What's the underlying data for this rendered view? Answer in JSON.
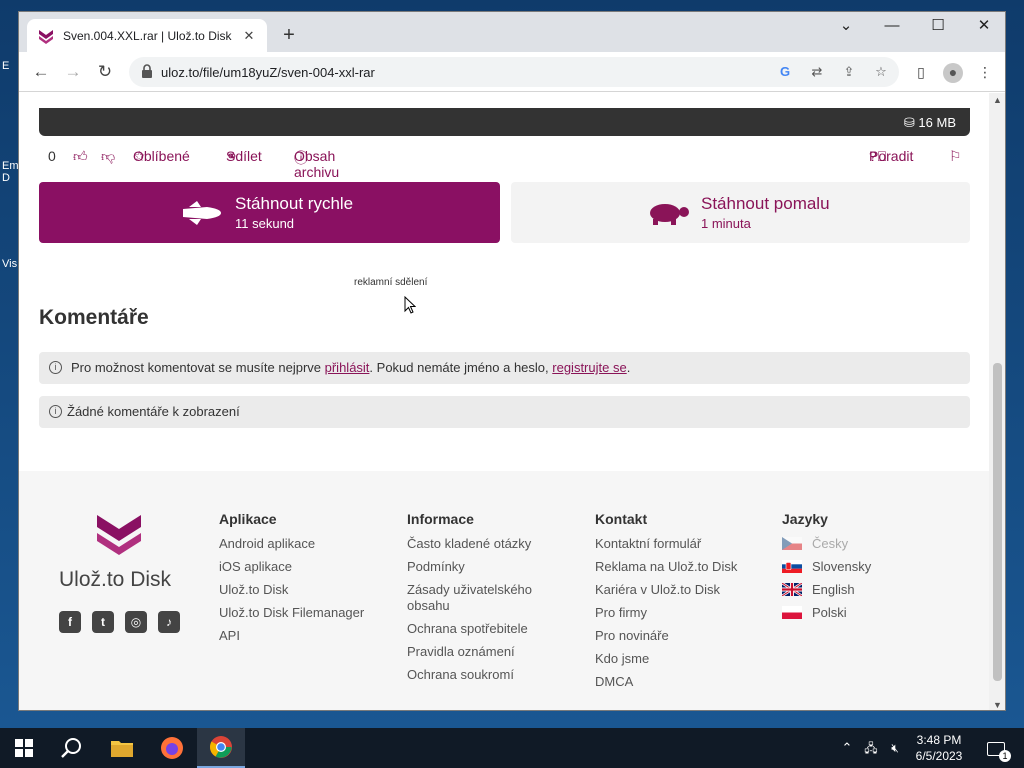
{
  "browser": {
    "tab_title": "Sven.004.XXL.rar | Ulož.to Disk",
    "url": "uloz.to/file/um18yuZ/sven-004-xxl-rar"
  },
  "file": {
    "size": "16 MB",
    "like_count": "0",
    "favorites_label": "Oblíbené",
    "share_label": "Sdílet",
    "archive_label": "Obsah archivu",
    "help_label": "Poradit"
  },
  "download": {
    "fast_title": "Stáhnout rychle",
    "fast_time": "11 sekund",
    "slow_title": "Stáhnout pomalu",
    "slow_time": "1 minuta"
  },
  "ad_label": "reklamní sdělení",
  "comments": {
    "heading": "Komentáře",
    "login_prefix": "Pro možnost komentovat se musíte nejprve ",
    "login_link": "přihlásit",
    "login_middle": ". Pokud nemáte jméno a heslo, ",
    "register_link": "registrujte se",
    "login_suffix": ".",
    "empty_text": "Žádné komentáře k zobrazení"
  },
  "footer": {
    "logo_text": "Ulož.to Disk",
    "apps": {
      "title": "Aplikace",
      "links": [
        "Android aplikace",
        "iOS aplikace",
        "Ulož.to Disk",
        "Ulož.to Disk Filemanager",
        "API"
      ]
    },
    "info": {
      "title": "Informace",
      "links": [
        "Často kladené otázky",
        "Podmínky",
        "Zásady uživatelského obsahu",
        "Ochrana spotřebitele",
        "Pravidla oznámení",
        "Ochrana soukromí"
      ]
    },
    "contact": {
      "title": "Kontakt",
      "links": [
        "Kontaktní formulář",
        "Reklama na Ulož.to Disk",
        "Kariéra v Ulož.to Disk",
        "Pro firmy",
        "Pro novináře",
        "Kdo jsme",
        "DMCA"
      ]
    },
    "languages": {
      "title": "Jazyky",
      "items": [
        "Česky",
        "Slovensky",
        "English",
        "Polski"
      ]
    }
  },
  "taskbar": {
    "time": "3:48 PM",
    "date": "6/5/2023",
    "notifications": "1"
  },
  "colors": {
    "brand": "#8a1063",
    "accent_text": "#8a1458"
  }
}
